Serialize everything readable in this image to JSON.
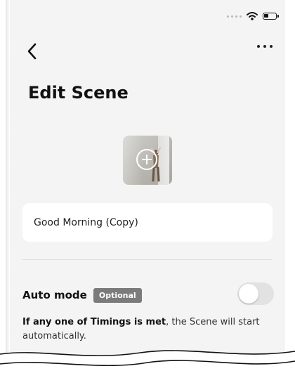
{
  "header": {
    "title": "Edit Scene"
  },
  "scene": {
    "name_value": "Good Morning (Copy)"
  },
  "auto_mode": {
    "label": "Auto mode",
    "badge": "Optional",
    "enabled": false,
    "description_bold": "If any one of Timings is met",
    "description_rest": ", the Scene will start automatically."
  },
  "icons": {
    "back": "chevron-left-icon",
    "more": "more-horizontal-icon",
    "add_photo": "add-circle-icon",
    "wifi": "wifi-icon",
    "battery": "battery-icon"
  },
  "colors": {
    "background": "#f4f4f4",
    "card": "#ffffff",
    "badge": "#7b7b7b",
    "toggle_off": "#e2e2e2"
  }
}
